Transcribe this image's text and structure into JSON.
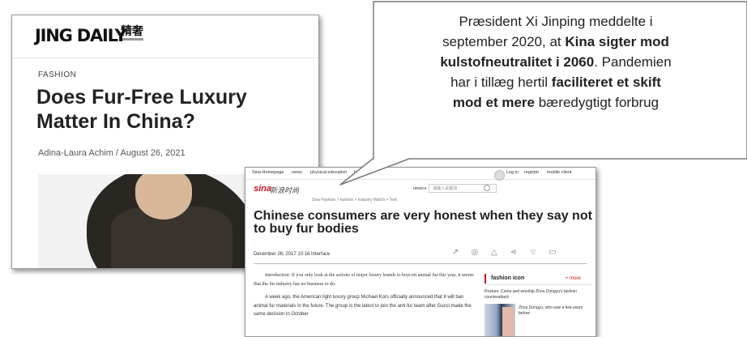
{
  "jing_daily": {
    "logo": "JING DAILY",
    "logo_cn": "精奢",
    "category": "FASHION",
    "title": "Does Fur-Free Luxury Matter In China?",
    "byline": "Adina-Laura Achim / August 26, 2021"
  },
  "sina": {
    "topnav": [
      "Sina Homepage",
      "news",
      "physical education",
      "f"
    ],
    "logo": "sina",
    "logo_cn": "新浪时尚",
    "news_menu": "news∨",
    "search_placeholder": "请输入关键词",
    "login": "Log in",
    "register": "register",
    "mobile": "mobile client",
    "breadcrumb": "Sina Fashion > fashion > Industry Watch > Text",
    "title": "Chinese consumers are very honest when they say not to buy fur bodies",
    "date": "December 26, 2017 10:16  Interface",
    "share_icons": [
      "share-icon",
      "comment-icon",
      "like-icon",
      "forward-icon",
      "star-icon",
      "message-icon"
    ],
    "body": [
      "Introduction: If you only look at the actions of major luxury brands to boycott animal fur this year, it seems that the fur industry has no business to do.",
      "A week ago, the American light luxury group Michael Kors officially announced that it will ban animal fur materials in the future. The group is the latest to join the anti-fur team after Gucci made the same decision in October"
    ],
    "sidebar": {
      "title": "fashion icon",
      "more": "+ more",
      "post": "Posture: Come and worship Zhou Dongyu's fashion counterattack",
      "text": "Zhou Dongyu, who was a few years before"
    }
  },
  "bubble": {
    "line1": "Præsident Xi Jinping meddelte i",
    "line2_a": "september 2020, at ",
    "line2_b": "Kina sigter mod",
    "line3_a": "kulstofneutralitet i 2060",
    "line3_b": ". Pandemien",
    "line4_a": "har i tillæg hertil ",
    "line4_b": "faciliteret et skift",
    "line5_a": "mod et mere",
    "line5_b": " bæredygtigt forbrug"
  }
}
